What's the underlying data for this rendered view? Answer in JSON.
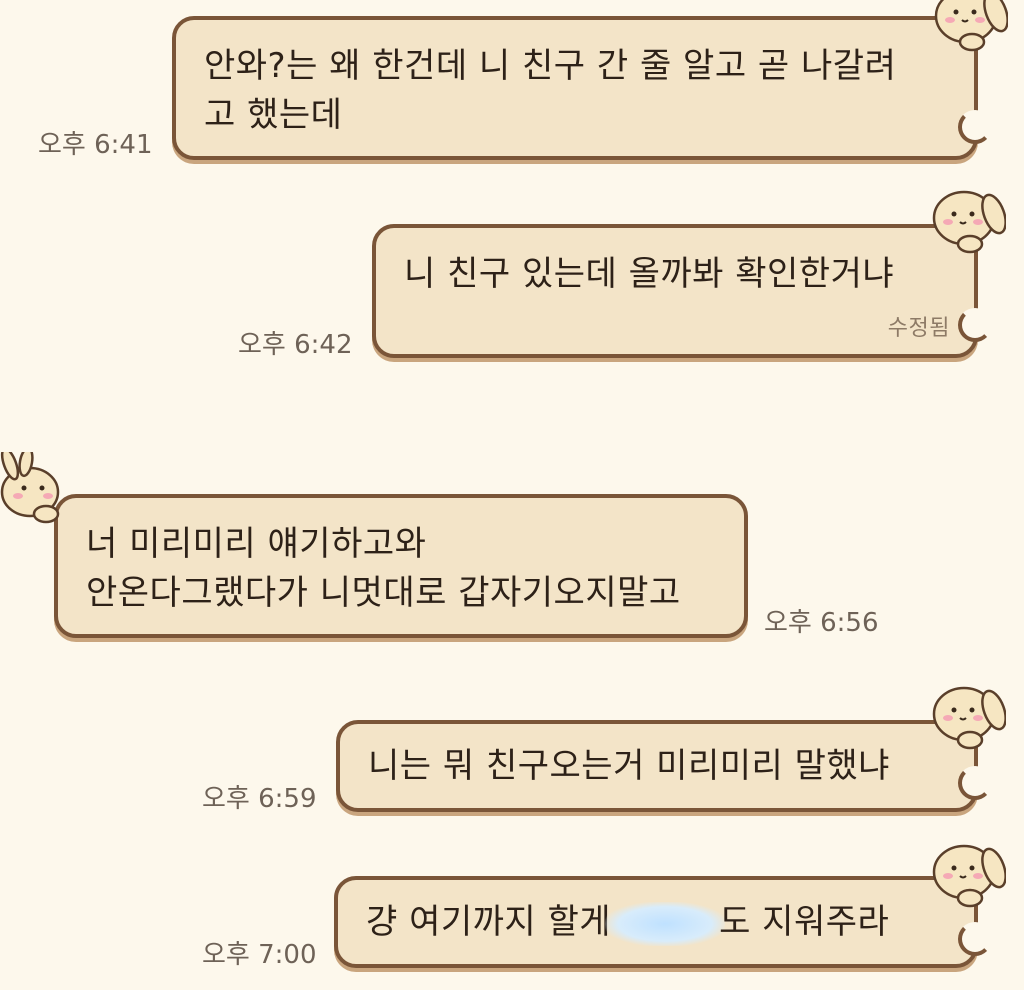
{
  "messages": [
    {
      "id": "m1",
      "side": "outgoing",
      "text": "안와?는 왜 한건데 니 친구 간 줄 알고 곧 나갈려\n고 했는데",
      "time": "오후 6:41"
    },
    {
      "id": "m2",
      "side": "outgoing",
      "text": "니 친구 있는데 올까봐 확인한거냐",
      "edited_label": "수정됨",
      "time": "오후 6:42"
    },
    {
      "id": "m3",
      "side": "incoming",
      "text": "너 미리미리 얘기하고와\n안온다그랬다가 니멋대로 갑자기오지말고",
      "time": "오후 6:56"
    },
    {
      "id": "m4",
      "side": "outgoing",
      "text": "니는 뭐 친구오는거 미리미리 말했냐",
      "time": "오후 6:59"
    },
    {
      "id": "m5",
      "side": "outgoing",
      "text_before": "걍 여기까지 할게",
      "text_after": "도 지워주라",
      "time": "오후 7:00"
    }
  ],
  "colors": {
    "background": "#fdf8ec",
    "bubble": "#f3e4c8",
    "bubble_border": "#7a5538",
    "bubble_shadow": "#c9a57e",
    "time_text": "#6e6257",
    "redaction": "#bfe1ff"
  },
  "icons": {
    "bunny_sticker": "bunny-peek-icon",
    "bunny_incoming": "bunny-peek-left-icon"
  }
}
